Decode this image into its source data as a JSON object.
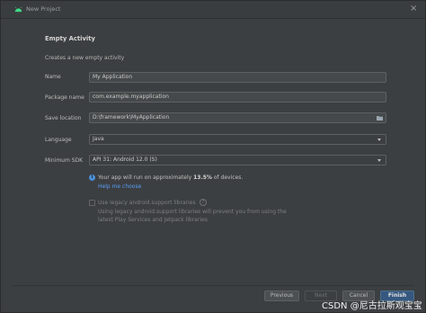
{
  "window": {
    "title": "New Project"
  },
  "header": {
    "heading": "Empty Activity",
    "subheading": "Creates a new empty activity"
  },
  "form": {
    "name": {
      "label": "Name",
      "value": "My Application"
    },
    "package": {
      "label": "Package name",
      "value": "com.example.myapplication"
    },
    "save_location": {
      "label": "Save location",
      "value": "D:\\framework\\MyApplication",
      "icon": "folder-icon"
    },
    "language": {
      "label": "Language",
      "value": "Java"
    },
    "min_sdk": {
      "label": "Minimum SDK",
      "value": "API 31: Android 12.0 (S)"
    }
  },
  "info": {
    "prefix": "Your app will run on approximately ",
    "percent": "13.5%",
    "suffix": " of devices.",
    "help_link": "Help me choose"
  },
  "legacy": {
    "label": "Use legacy android.support libraries",
    "description": "Using legacy android.support libraries will prevent you from using the latest Play Services and Jetpack libraries",
    "checked": false
  },
  "buttons": {
    "previous": "Previous",
    "next": "Next",
    "cancel": "Cancel",
    "finish": "Finish"
  },
  "watermark": "CSDN @尼古拉斯观宝宝",
  "colors": {
    "primary_button": "#365880",
    "link": "#589df6",
    "android_green": "#3ddc84"
  }
}
